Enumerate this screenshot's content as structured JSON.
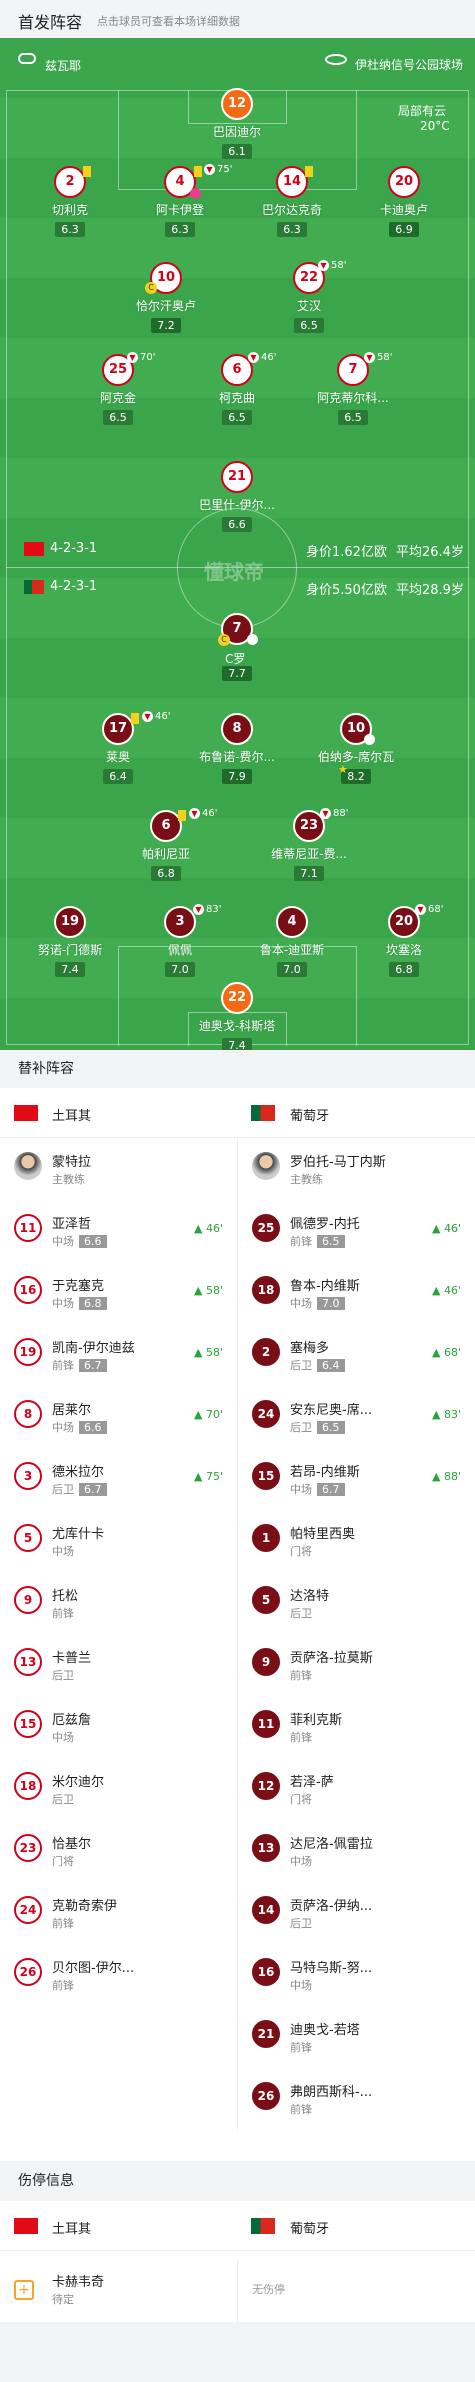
{
  "header": {
    "title": "首发阵容",
    "subtitle": "点击球员可查看本场详细数据"
  },
  "pitch": {
    "referee": "兹瓦耶",
    "stadium": "伊杜纳信号公园球场",
    "weather": "局部有云",
    "temp": "20°C",
    "watermark": "懂球帝"
  },
  "turkey_formation": {
    "formation": "4-2-3-1",
    "value": "身价1.62亿欧",
    "age": "平均26.4岁"
  },
  "portugal_formation": {
    "formation": "4-2-3-1",
    "value": "身价5.50亿欧",
    "age": "平均28.9岁"
  },
  "turkey_players": [
    {
      "num": "12",
      "name": "巴因迪尔",
      "rating": "6.1"
    },
    {
      "num": "2",
      "name": "切利克",
      "rating": "6.3"
    },
    {
      "num": "4",
      "name": "阿卡伊登",
      "rating": "6.3",
      "sub": "75'"
    },
    {
      "num": "14",
      "name": "巴尔达克奇",
      "rating": "6.3"
    },
    {
      "num": "20",
      "name": "卡迪奥卢",
      "rating": "6.9"
    },
    {
      "num": "10",
      "name": "恰尔汗奥卢",
      "rating": "7.2"
    },
    {
      "num": "22",
      "name": "艾汉",
      "rating": "6.5",
      "sub": "58'"
    },
    {
      "num": "25",
      "name": "阿克金",
      "rating": "6.5",
      "sub": "70'"
    },
    {
      "num": "6",
      "name": "柯克曲",
      "rating": "6.5",
      "sub": "46'"
    },
    {
      "num": "7",
      "name": "阿克蒂尔科...",
      "rating": "6.5",
      "sub": "58'"
    },
    {
      "num": "21",
      "name": "巴里什-伊尔...",
      "rating": "6.6"
    }
  ],
  "portugal_players": [
    {
      "num": "7",
      "name": "C罗",
      "rating": "7.7"
    },
    {
      "num": "17",
      "name": "莱奥",
      "rating": "6.4",
      "sub": "46'"
    },
    {
      "num": "8",
      "name": "布鲁诺-费尔...",
      "rating": "7.9"
    },
    {
      "num": "10",
      "name": "伯纳多-席尔瓦",
      "rating": "8.2"
    },
    {
      "num": "6",
      "name": "帕利尼亚",
      "rating": "6.8",
      "sub": "46'"
    },
    {
      "num": "23",
      "name": "维蒂尼亚-费...",
      "rating": "7.1",
      "sub": "88'"
    },
    {
      "num": "19",
      "name": "努诺-门德斯",
      "rating": "7.4"
    },
    {
      "num": "3",
      "name": "佩佩",
      "rating": "7.0",
      "sub": "83'"
    },
    {
      "num": "4",
      "name": "鲁本-迪亚斯",
      "rating": "7.0"
    },
    {
      "num": "20",
      "name": "坎塞洛",
      "rating": "6.8",
      "sub": "68'"
    },
    {
      "num": "22",
      "name": "迪奥戈-科斯塔",
      "rating": "7.4"
    }
  ],
  "subs_section": {
    "title": "替补阵容",
    "team_left": "土耳其",
    "team_right": "葡萄牙"
  },
  "coaches": [
    {
      "name": "蒙特拉",
      "role": "主教练"
    },
    {
      "name": "罗伯托-马丁内斯",
      "role": "主教练"
    }
  ],
  "subs_left": [
    {
      "num": "11",
      "name": "亚泽哲",
      "pos": "中场",
      "rating": "6.6",
      "min": "46'"
    },
    {
      "num": "16",
      "name": "于克塞克",
      "pos": "中场",
      "rating": "6.8",
      "min": "58'"
    },
    {
      "num": "19",
      "name": "凯南-伊尔迪兹",
      "pos": "前锋",
      "rating": "6.7",
      "min": "58'"
    },
    {
      "num": "8",
      "name": "居莱尔",
      "pos": "中场",
      "rating": "6.6",
      "min": "70'"
    },
    {
      "num": "3",
      "name": "德米拉尔",
      "pos": "后卫",
      "rating": "6.7",
      "min": "75'"
    },
    {
      "num": "5",
      "name": "尤库什卡",
      "pos": "中场"
    },
    {
      "num": "9",
      "name": "托松",
      "pos": "前锋"
    },
    {
      "num": "13",
      "name": "卡普兰",
      "pos": "后卫"
    },
    {
      "num": "15",
      "name": "厄兹詹",
      "pos": "中场"
    },
    {
      "num": "18",
      "name": "米尔迪尔",
      "pos": "后卫"
    },
    {
      "num": "23",
      "name": "恰基尔",
      "pos": "门将"
    },
    {
      "num": "24",
      "name": "克勒奇索伊",
      "pos": "前锋"
    },
    {
      "num": "26",
      "name": "贝尔图-伊尔...",
      "pos": "前锋"
    }
  ],
  "subs_right": [
    {
      "num": "25",
      "name": "佩德罗-内托",
      "pos": "前锋",
      "rating": "6.5",
      "min": "46'"
    },
    {
      "num": "18",
      "name": "鲁本-内维斯",
      "pos": "中场",
      "rating": "7.0",
      "min": "46'"
    },
    {
      "num": "2",
      "name": "塞梅多",
      "pos": "后卫",
      "rating": "6.4",
      "min": "68'"
    },
    {
      "num": "24",
      "name": "安东尼奥-席...",
      "pos": "后卫",
      "rating": "6.5",
      "min": "83'"
    },
    {
      "num": "15",
      "name": "若昂-内维斯",
      "pos": "中场",
      "rating": "6.7",
      "min": "88'"
    },
    {
      "num": "1",
      "name": "帕特里西奥",
      "pos": "门将"
    },
    {
      "num": "5",
      "name": "达洛特",
      "pos": "后卫"
    },
    {
      "num": "9",
      "name": "贡萨洛-拉莫斯",
      "pos": "前锋"
    },
    {
      "num": "11",
      "name": "菲利克斯",
      "pos": "前锋"
    },
    {
      "num": "12",
      "name": "若泽-萨",
      "pos": "门将"
    },
    {
      "num": "13",
      "name": "达尼洛-佩雷拉",
      "pos": "中场"
    },
    {
      "num": "14",
      "name": "贡萨洛-伊纳...",
      "pos": "后卫"
    },
    {
      "num": "16",
      "name": "马特乌斯-努...",
      "pos": "中场"
    },
    {
      "num": "21",
      "name": "迪奥戈-若塔",
      "pos": "前锋"
    },
    {
      "num": "26",
      "name": "弗朗西斯科-...",
      "pos": "前锋"
    }
  ],
  "injury_section": {
    "title": "伤停信息",
    "team_left": "土耳其",
    "team_right": "葡萄牙",
    "left_player": "卡赫韦奇",
    "left_status": "待定",
    "right_none": "无伤停"
  },
  "colors": {
    "pitch": "#3aa54a",
    "turkey": "#d0021b",
    "portugal": "#7a0e17",
    "gk": "#f56b15"
  }
}
